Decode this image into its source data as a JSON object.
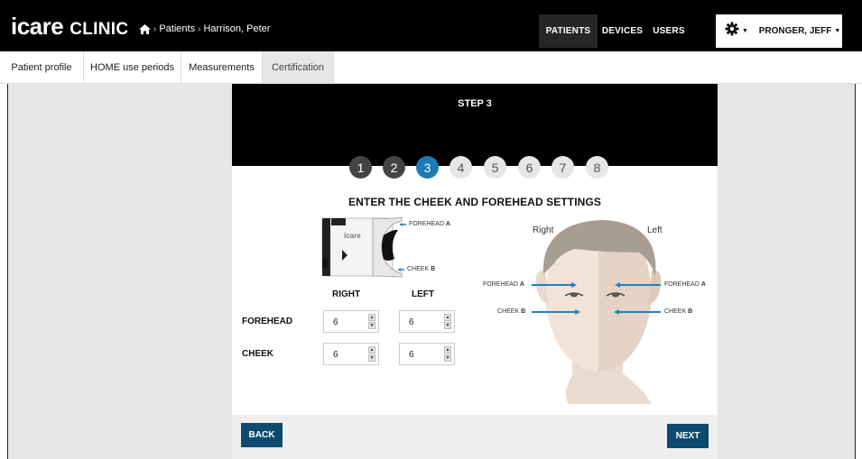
{
  "brand": {
    "main": "icare",
    "sub": "CLINIC"
  },
  "breadcrumb": {
    "home_sep": "›",
    "patients": "Patients",
    "sep": "›",
    "current": "Harrison, Peter"
  },
  "topnav": {
    "patients": "PATIENTS",
    "devices": "DEVICES",
    "users": "USERS"
  },
  "user_menu": {
    "name": "PRONGER, JEFF",
    "caret": "▼"
  },
  "tabs": [
    {
      "label": "Patient profile"
    },
    {
      "label": "HOME use periods"
    },
    {
      "label": "Measurements"
    },
    {
      "label": "Certification"
    }
  ],
  "wizard": {
    "step_title": "STEP 3",
    "steps": [
      "1",
      "2",
      "3",
      "4",
      "5",
      "6",
      "7",
      "8"
    ],
    "current_step": 3,
    "section_title": "ENTER THE CHEEK AND FOREHEAD SETTINGS",
    "device_brand": "icare",
    "forehead_label": "FOREHEAD",
    "forehead_letter": "A",
    "cheek_label": "CHEEK",
    "cheek_letter": "B",
    "col_right": "RIGHT",
    "col_left": "LEFT",
    "row_forehead": "FOREHEAD",
    "row_cheek": "CHEEK",
    "values": {
      "forehead_right": "6",
      "forehead_left": "6",
      "cheek_right": "6",
      "cheek_left": "6"
    },
    "face": {
      "right": "Right",
      "left": "Left",
      "forehead_label": "FOREHEAD",
      "forehead_letter": "A",
      "cheek_label": "CHEEK",
      "cheek_letter": "B"
    },
    "back_label": "BACK",
    "next_label": "NEXT"
  },
  "colors": {
    "accent": "#1a7bb5",
    "button": "#0e4a6e",
    "arrow": "#1f82bf",
    "skin_light": "#f1e3d7",
    "skin_dark": "#e2d2c3",
    "hair": "#a89d93"
  }
}
